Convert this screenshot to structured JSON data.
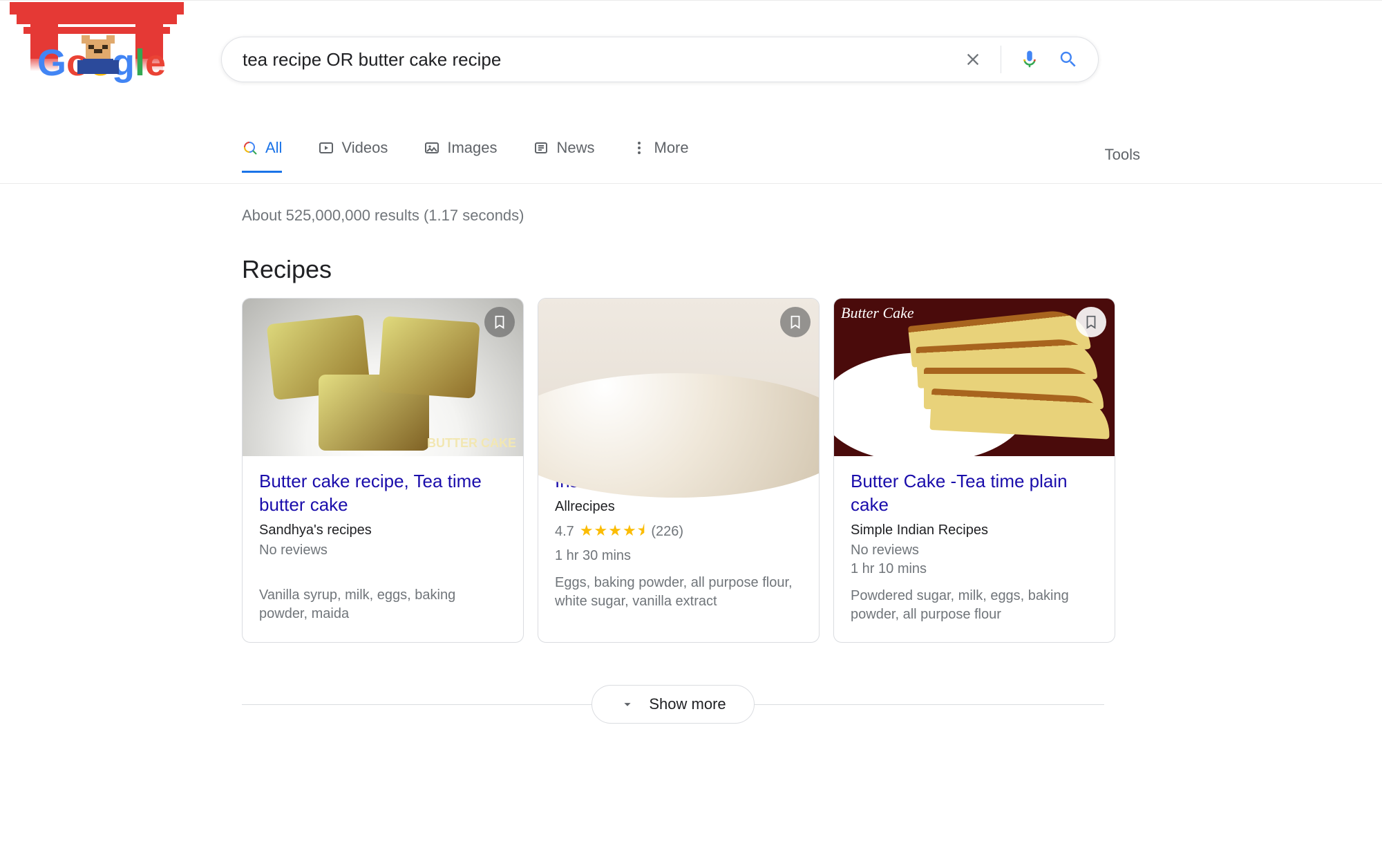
{
  "search": {
    "query": "tea recipe OR butter cake recipe"
  },
  "tabs": {
    "all": "All",
    "videos": "Videos",
    "images": "Images",
    "news": "News",
    "more": "More",
    "tools": "Tools"
  },
  "stats": "About 525,000,000 results (1.17 seconds)",
  "section_title": "Recipes",
  "cards": [
    {
      "title": "Butter cake recipe, Tea time butter cake",
      "source": "Sandhya's recipes",
      "reviews_text": "No reviews",
      "rating": null,
      "rating_count": null,
      "time": "",
      "ingredients": "Vanilla syrup, milk, eggs, baking powder, maida",
      "watermark": "BUTTER CAKE"
    },
    {
      "title": "Irish Tea Cake",
      "source": "Allrecipes",
      "reviews_text": null,
      "rating": "4.7",
      "rating_count": "(226)",
      "time": "1 hr 30 mins",
      "ingredients": "Eggs, baking powder, all purpose flour, white sugar, vanilla extract",
      "watermark": ""
    },
    {
      "title": "Butter Cake -Tea time plain cake",
      "source": "Simple Indian Recipes",
      "reviews_text": "No reviews",
      "rating": null,
      "rating_count": null,
      "time": "1 hr 10 mins",
      "ingredients": "Powdered sugar, milk, eggs, baking powder, all purpose flour",
      "watermark": "Butter Cake"
    }
  ],
  "show_more": "Show more"
}
